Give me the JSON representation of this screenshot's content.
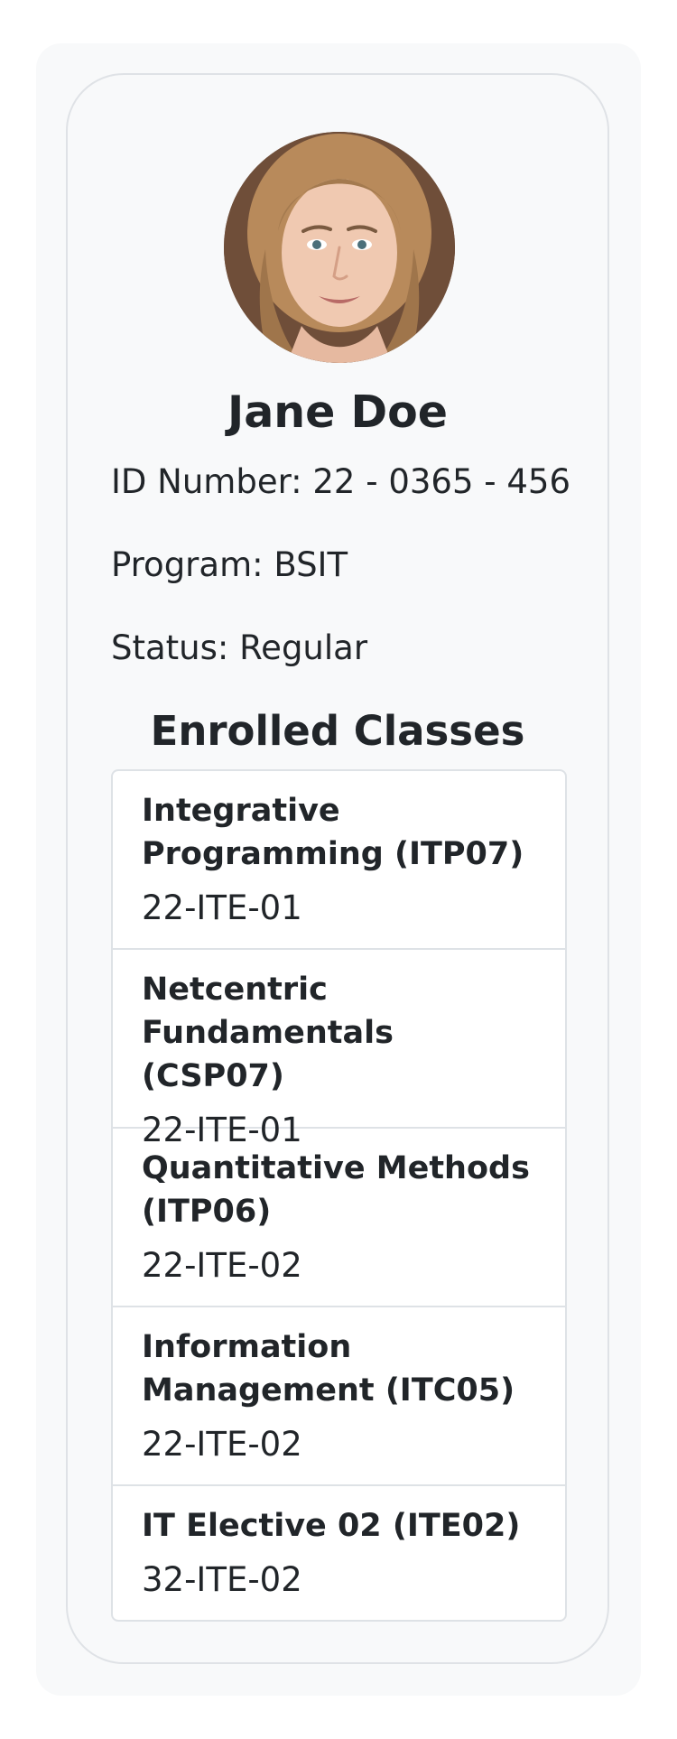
{
  "student": {
    "name": "Jane Doe",
    "id_line": "ID Number: 22 - 0365 - 456",
    "program_line": "Program: BSIT",
    "status_line": "Status: Regular"
  },
  "enrolled": {
    "title": "Enrolled Classes",
    "classes": [
      {
        "name": "Integrative Programming (ITP07)",
        "section": "22-ITE-01"
      },
      {
        "name": "Netcentric Fundamentals (CSP07)",
        "section": "22-ITE-01"
      },
      {
        "name": "Quantitative Methods (ITP06)",
        "section": "22-ITE-02"
      },
      {
        "name": "Information Management (ITC05)",
        "section": "22-ITE-02"
      },
      {
        "name": "IT Elective 02 (ITE02)",
        "section": "32-ITE-02"
      }
    ]
  }
}
